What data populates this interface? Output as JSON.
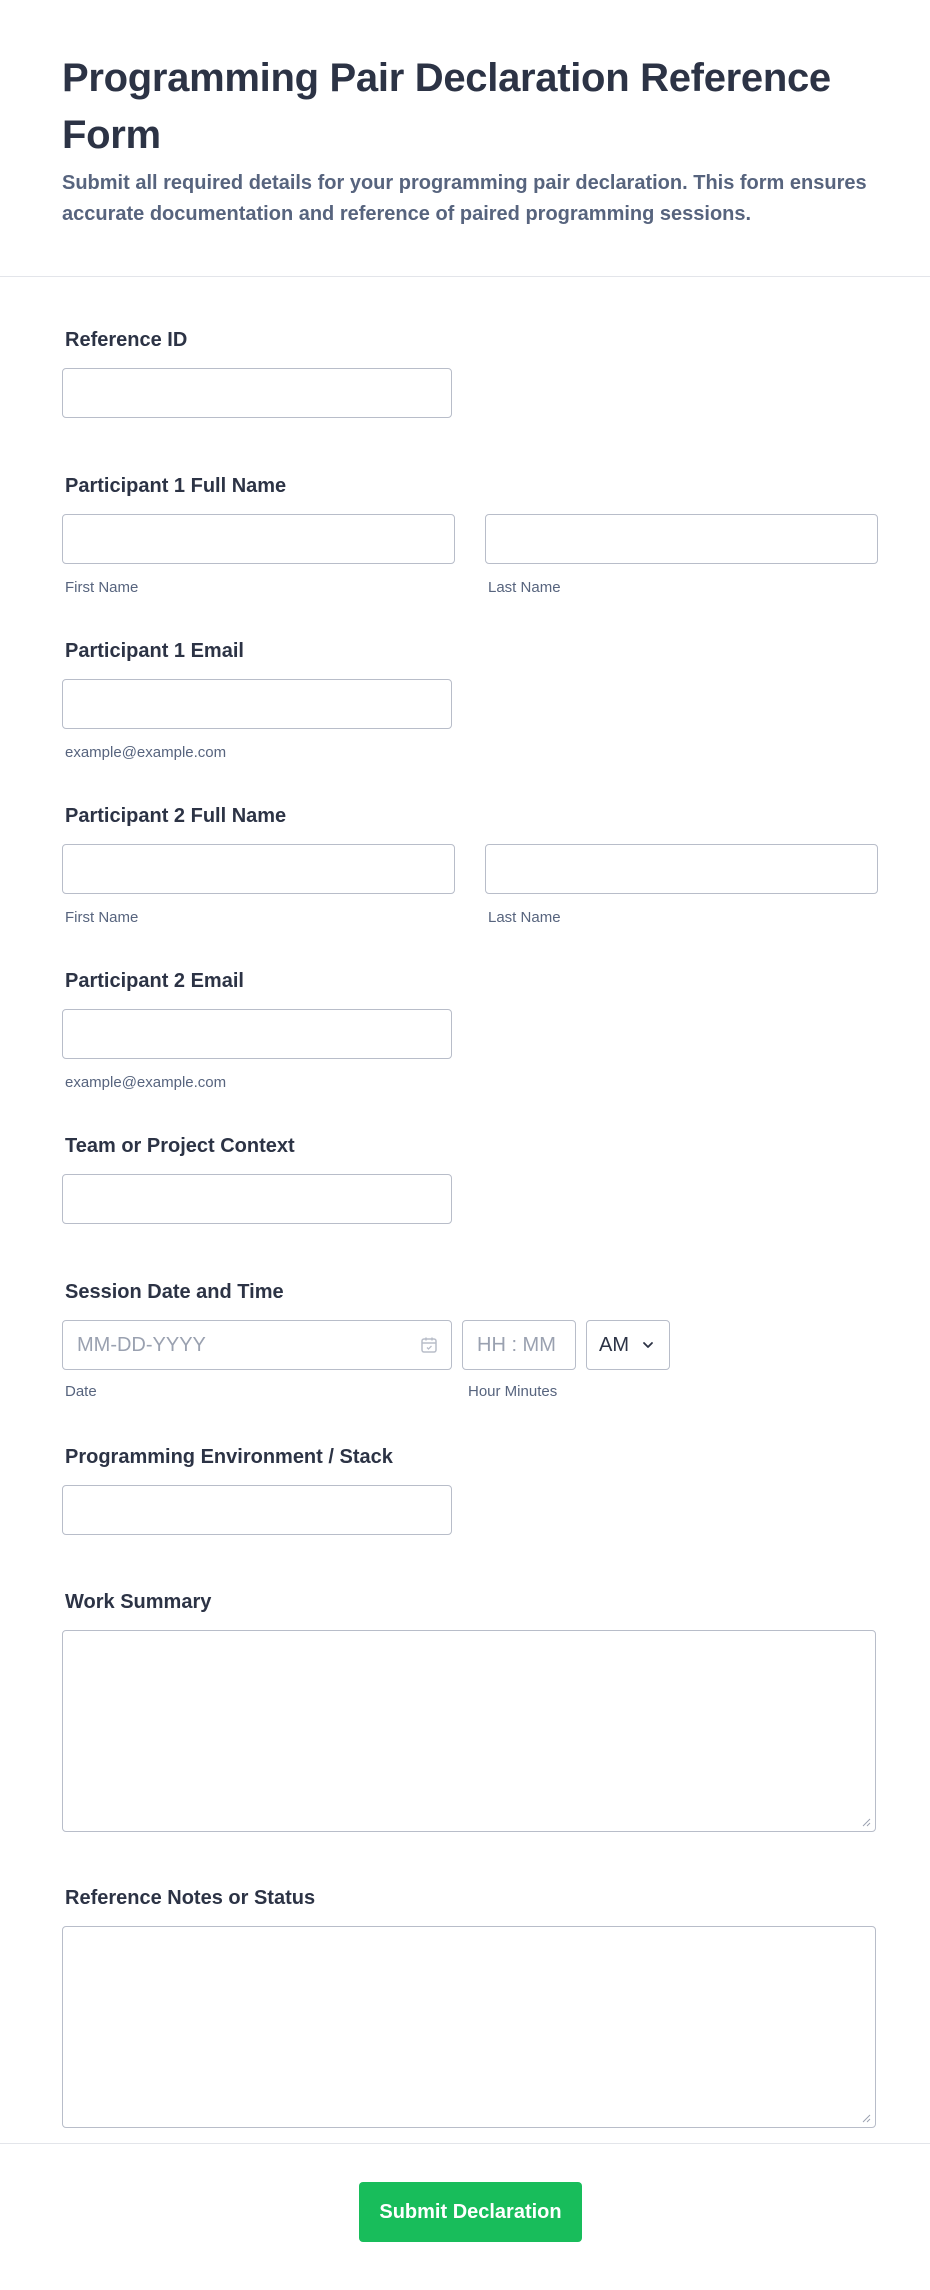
{
  "header": {
    "title": "Programming Pair Declaration Reference Form",
    "subtitle": "Submit all required details for your programming pair declaration. This form ensures accurate documentation and reference of paired programming sessions."
  },
  "fields": {
    "reference_id": {
      "label": "Reference ID",
      "value": ""
    },
    "participant1_name": {
      "label": "Participant 1 Full Name",
      "first_sublabel": "First Name",
      "last_sublabel": "Last Name",
      "first_value": "",
      "last_value": ""
    },
    "participant1_email": {
      "label": "Participant 1 Email",
      "sublabel": "example@example.com",
      "value": ""
    },
    "participant2_name": {
      "label": "Participant 2 Full Name",
      "first_sublabel": "First Name",
      "last_sublabel": "Last Name",
      "first_value": "",
      "last_value": ""
    },
    "participant2_email": {
      "label": "Participant 2 Email",
      "sublabel": "example@example.com",
      "value": ""
    },
    "team_context": {
      "label": "Team or Project Context",
      "value": ""
    },
    "session": {
      "label": "Session Date and Time",
      "date_placeholder": "MM-DD-YYYY",
      "time_placeholder": "HH : MM",
      "ampm_value": "AM",
      "date_sublabel": "Date",
      "time_sublabel": "Hour Minutes"
    },
    "environment": {
      "label": "Programming Environment / Stack",
      "value": ""
    },
    "work_summary": {
      "label": "Work Summary",
      "value": ""
    },
    "reference_notes": {
      "label": "Reference Notes or Status",
      "value": ""
    }
  },
  "icons": {
    "date_picker": "calendar-icon",
    "select_arrow": "chevron-down-icon",
    "resize": "resize-grip-icon"
  },
  "footer": {
    "submit_label": "Submit Declaration"
  },
  "colors": {
    "accent": "#18bd5b",
    "text": "#2c3345",
    "muted": "#57647e",
    "border": "#b8bdc9"
  }
}
